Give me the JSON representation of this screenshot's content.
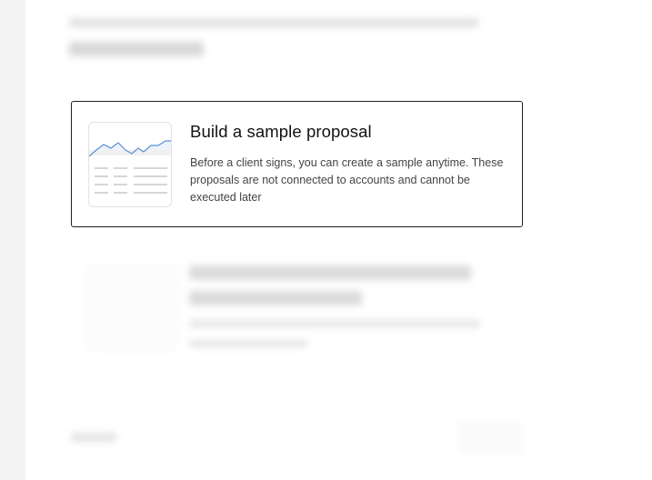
{
  "card": {
    "title": "Build a sample proposal",
    "description": "Before a client signs, you can create a sample anytime. These proposals are not connected to accounts and cannot be executed later"
  },
  "icons": {
    "thumbnail": "chart-table-preview-icon"
  },
  "colors": {
    "card_border": "#1f1f1f",
    "chart_line": "#5b8fd6",
    "chart_fill": "#eef3fb"
  }
}
